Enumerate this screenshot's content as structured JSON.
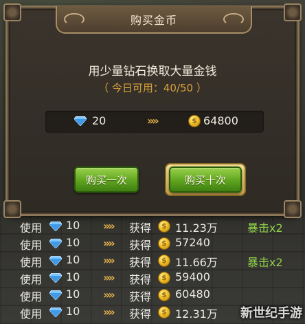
{
  "dialog": {
    "title": "购买金币",
    "headline": "用少量钻石换取大量金钱",
    "quota": "（ 今日可用：40/50 ）",
    "exchange": {
      "gem_cost": "20",
      "arrows": "»»",
      "coin_amount": "64800"
    },
    "buttons": {
      "buy_once": "购买一次",
      "buy_ten": "购买十次"
    }
  },
  "results": [
    {
      "use": "使用",
      "cost": "10",
      "arrows": "»»",
      "get": "获得",
      "amount": "11.23万",
      "crit": "暴击x2"
    },
    {
      "use": "使用",
      "cost": "10",
      "arrows": "»»",
      "get": "获得",
      "amount": "57240",
      "crit": ""
    },
    {
      "use": "使用",
      "cost": "10",
      "arrows": "»»",
      "get": "获得",
      "amount": "11.66万",
      "crit": "暴击x2"
    },
    {
      "use": "使用",
      "cost": "10",
      "arrows": "»»",
      "get": "获得",
      "amount": "59400",
      "crit": ""
    },
    {
      "use": "使用",
      "cost": "10",
      "arrows": "»»",
      "get": "获得",
      "amount": "60480",
      "crit": ""
    },
    {
      "use": "使用",
      "cost": "10",
      "arrows": "»»",
      "get": "获得",
      "amount": "12.31万",
      "crit": ""
    }
  ],
  "watermark": "新世纪手游",
  "icons": {
    "gem": "diamond-icon",
    "coin": "gold-coin-icon",
    "arrows": "double-chevron-right-icon"
  },
  "colors": {
    "accent_gold": "#d9a23b",
    "button_green": "#5fa41f",
    "crit_green": "#8fd14a"
  }
}
